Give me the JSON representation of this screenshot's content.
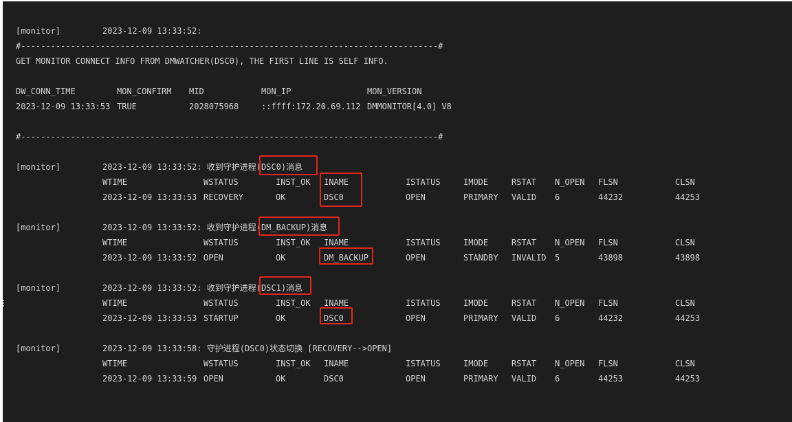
{
  "header": {
    "tag": "[monitor]",
    "timestamp": "2023-12-09 13:33:52:",
    "separator_top": "#------------------------------------------------------------------------------------#",
    "info_line": "GET MONITOR CONNECT INFO FROM DMWATCHER(DSC0), THE FIRST LINE IS SELF INFO.",
    "separator_bottom": "#------------------------------------------------------------------------------------#"
  },
  "conn_table": {
    "headers": [
      "DW_CONN_TIME",
      "MON_CONFIRM",
      "MID",
      "MON_IP",
      "MON_VERSION"
    ],
    "row": [
      "2023-12-09 13:33:53",
      "TRUE",
      "2028075968",
      "::ffff:172.20.69.112",
      "DMMONITOR[4.0] V8"
    ]
  },
  "blocks": [
    {
      "tag": "[monitor]",
      "message": "2023-12-09 13:33:52: 收到守护进程(DSC0)消息",
      "headers": [
        "WTIME",
        "WSTATUS",
        "INST_OK",
        "INAME",
        "ISTATUS",
        "IMODE",
        "RSTAT",
        "N_OPEN",
        "FLSN",
        "CLSN"
      ],
      "row": [
        "2023-12-09 13:33:53",
        "RECOVERY",
        "OK",
        "DSC0",
        "OPEN",
        "PRIMARY",
        "VALID",
        "6",
        "44232",
        "44253"
      ]
    },
    {
      "tag": "[monitor]",
      "message": "2023-12-09 13:33:52: 收到守护进程(DM_BACKUP)消息",
      "headers": [
        "WTIME",
        "WSTATUS",
        "INST_OK",
        "INAME",
        "ISTATUS",
        "IMODE",
        "RSTAT",
        "N_OPEN",
        "FLSN",
        "CLSN"
      ],
      "row": [
        "2023-12-09 13:33:52",
        "OPEN",
        "OK",
        "DM_BACKUP",
        "OPEN",
        "STANDBY",
        "INVALID",
        "5",
        "43898",
        "43898"
      ]
    },
    {
      "tag": "[monitor]",
      "message": "2023-12-09 13:33:52: 收到守护进程(DSC1)消息",
      "headers": [
        "WTIME",
        "WSTATUS",
        "INST_OK",
        "INAME",
        "ISTATUS",
        "IMODE",
        "RSTAT",
        "N_OPEN",
        "FLSN",
        "CLSN"
      ],
      "row": [
        "2023-12-09 13:33:53",
        "STARTUP",
        "OK",
        "DSC0",
        "OPEN",
        "PRIMARY",
        "VALID",
        "6",
        "44232",
        "44253"
      ]
    },
    {
      "tag": "[monitor]",
      "message": "2023-12-09 13:33:58: 守护进程(DSC0)状态切换 [RECOVERY-->OPEN]",
      "headers": [
        "WTIME",
        "WSTATUS",
        "INST_OK",
        "INAME",
        "ISTATUS",
        "IMODE",
        "RSTAT",
        "N_OPEN",
        "FLSN",
        "CLSN"
      ],
      "row": [
        "2023-12-09 13:33:59",
        "OPEN",
        "OK",
        "DSC0",
        "OPEN",
        "PRIMARY",
        "VALID",
        "6",
        "44253",
        "44253"
      ]
    }
  ],
  "colors": {
    "terminal_bg": "#1e1e1e",
    "text": "#d4d4d4",
    "highlight_box": "#e0261b"
  }
}
